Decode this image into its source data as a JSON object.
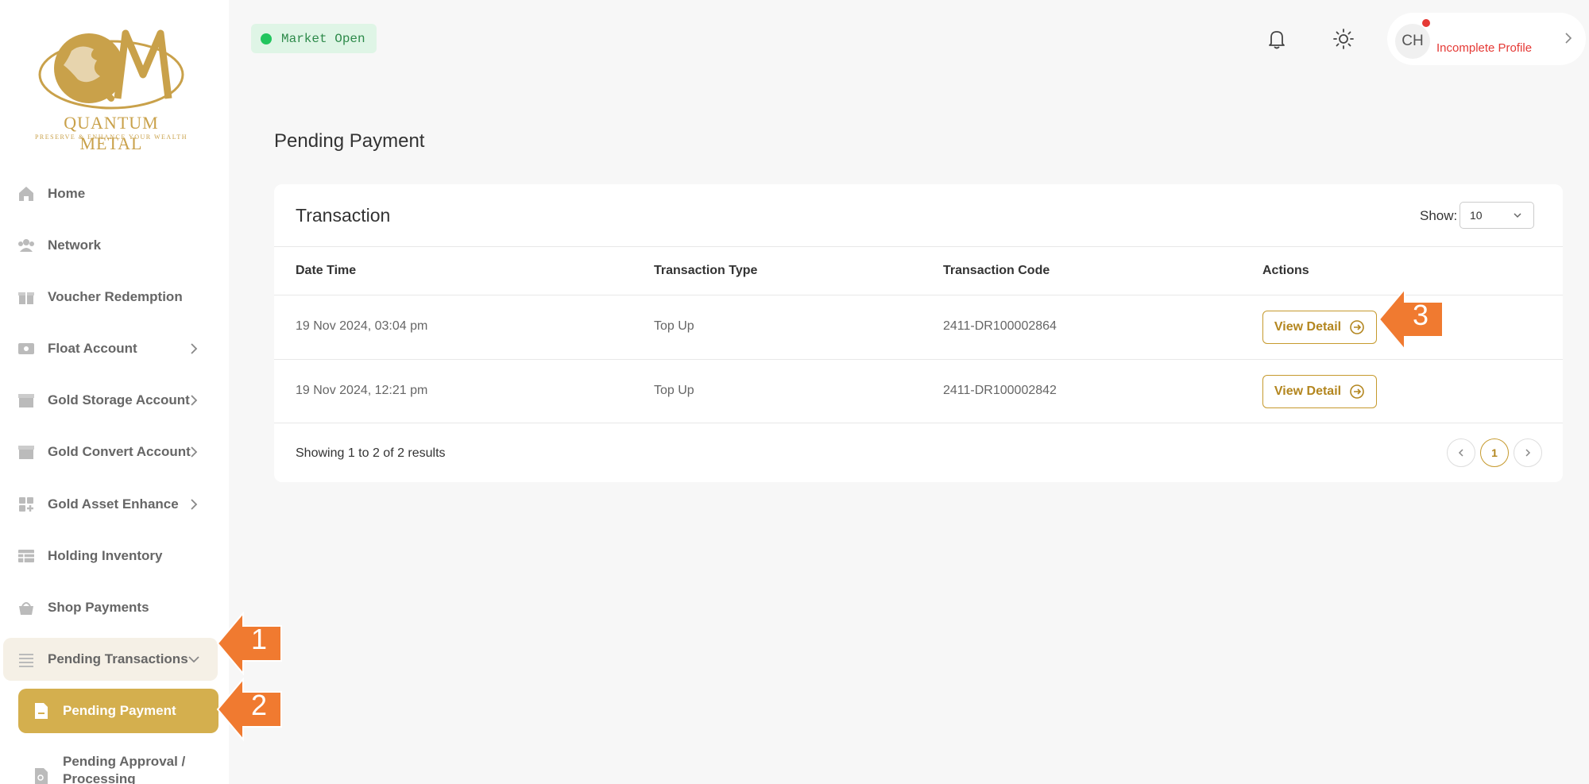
{
  "brand": {
    "name": "Quantum Metal",
    "tagline": "Preserve & Enhance Your Wealth"
  },
  "sidebar": {
    "items": [
      {
        "label": "Home",
        "icon": "home-icon"
      },
      {
        "label": "Network",
        "icon": "network-icon"
      },
      {
        "label": "Voucher Redemption",
        "icon": "gift-icon"
      },
      {
        "label": "Float Account",
        "icon": "cash-icon"
      },
      {
        "label": "Gold Storage Account",
        "icon": "box-icon"
      },
      {
        "label": "Gold Convert Account",
        "icon": "box-icon"
      },
      {
        "label": "Gold Asset Enhance",
        "icon": "grid-plus-icon"
      },
      {
        "label": "Holding Inventory",
        "icon": "table-icon"
      },
      {
        "label": "Shop Payments",
        "icon": "basket-icon"
      },
      {
        "label": "Pending Transactions",
        "icon": "list-icon"
      }
    ],
    "sub_items": [
      {
        "label": "Pending Payment",
        "icon": "document-icon"
      },
      {
        "label": "Pending Approval / Processing",
        "icon": "document-search-icon"
      }
    ]
  },
  "topbar": {
    "market_status": "Market Open",
    "avatar_initials": "CH",
    "profile_status": "Incomplete Profile"
  },
  "main": {
    "page_title": "Pending Payment",
    "card_title": "Transaction",
    "show_label": "Show:",
    "show_value": "10",
    "columns": [
      "Date Time",
      "Transaction Type",
      "Transaction Code",
      "Actions"
    ],
    "rows": [
      {
        "date_time": "19 Nov 2024, 03:04 pm",
        "type": "Top Up",
        "code": "2411-DR100002864",
        "action": "View Detail"
      },
      {
        "date_time": "19 Nov 2024, 12:21 pm",
        "type": "Top Up",
        "code": "2411-DR100002842",
        "action": "View Detail"
      }
    ],
    "footer_text": "Showing 1 to 2 of 2 results",
    "current_page": "1"
  },
  "callouts": [
    "1",
    "2",
    "3"
  ],
  "colors": {
    "gold": "#d4af4e",
    "accent_text": "#b3861f",
    "callout": "#f07a30",
    "market_green": "#22c55e",
    "alert_red": "#e53935"
  }
}
